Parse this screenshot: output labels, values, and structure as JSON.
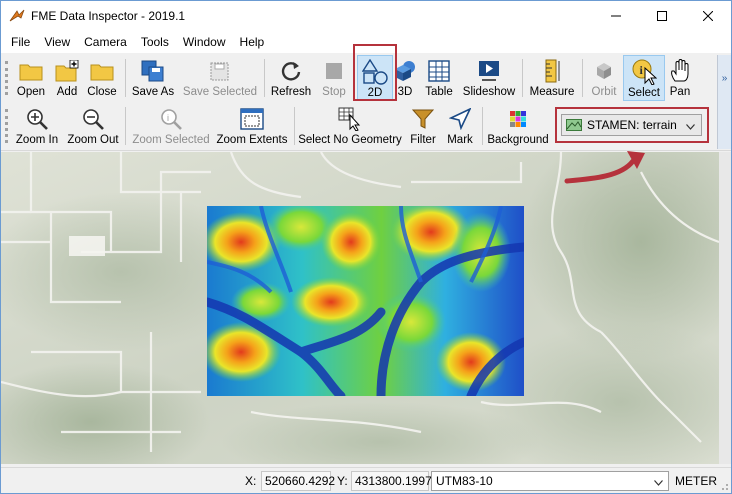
{
  "window": {
    "title": "FME Data Inspector - 2019.1"
  },
  "menu": [
    "File",
    "View",
    "Camera",
    "Tools",
    "Window",
    "Help"
  ],
  "toolbar1": {
    "open": "Open",
    "add": "Add",
    "close": "Close",
    "save_as": "Save As",
    "save_selected": "Save Selected",
    "refresh": "Refresh",
    "stop": "Stop",
    "view_2d": "2D",
    "view_3d": "3D",
    "table": "Table",
    "slideshow": "Slideshow",
    "measure": "Measure",
    "orbit": "Orbit",
    "select": "Select",
    "pan": "Pan"
  },
  "toolbar2": {
    "zoom_in": "Zoom In",
    "zoom_out": "Zoom Out",
    "zoom_selected": "Zoom Selected",
    "zoom_extents": "Zoom Extents",
    "select_no_geometry": "Select No Geometry",
    "filter": "Filter",
    "mark": "Mark",
    "background": "Background",
    "background_map": "STAMEN: terrain"
  },
  "status": {
    "x_label": "X:",
    "x_value": "520660.4292",
    "y_label": "Y:",
    "y_value": "4313800.1997",
    "coord_system": "UTM83-10",
    "units": "METER"
  },
  "colors": {
    "highlight": "#b5323c",
    "selected": "#cce4f7",
    "accent": "#2f6fbf"
  }
}
